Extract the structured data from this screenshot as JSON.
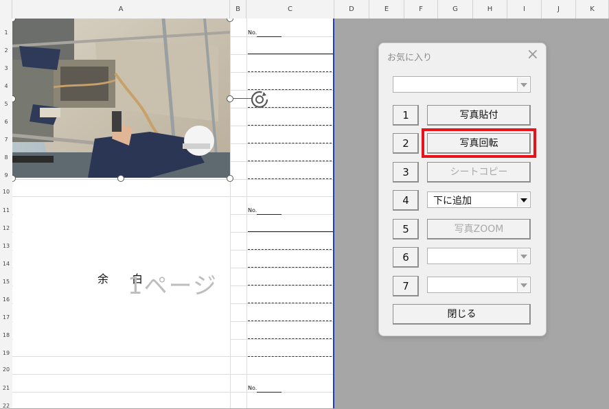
{
  "columns": [
    "A",
    "B",
    "C",
    "D",
    "E",
    "F",
    "G",
    "H",
    "I",
    "J",
    "K"
  ],
  "rows": [
    "1",
    "2",
    "3",
    "4",
    "5",
    "6",
    "7",
    "8",
    "9",
    "10",
    "11",
    "12",
    "13",
    "14",
    "15",
    "16",
    "17",
    "18",
    "19",
    "20",
    "21",
    "22"
  ],
  "sheet": {
    "no_label": "No.",
    "margin_char1": "余",
    "margin_char2": "白",
    "page_watermark": "1ページ"
  },
  "dialog": {
    "title": "お気に入り",
    "close_icon": "close-icon",
    "top_combo_value": "",
    "items": [
      {
        "num": "1",
        "type": "button",
        "label": "写真貼付",
        "enabled": true
      },
      {
        "num": "2",
        "type": "button",
        "label": "写真回転",
        "enabled": true,
        "highlighted": true
      },
      {
        "num": "3",
        "type": "button",
        "label": "シートコピー",
        "enabled": false
      },
      {
        "num": "4",
        "type": "combo",
        "value": "下に追加",
        "enabled": true
      },
      {
        "num": "5",
        "type": "button",
        "label": "写真ZOOM",
        "enabled": false
      },
      {
        "num": "6",
        "type": "combo",
        "value": "",
        "enabled": false
      },
      {
        "num": "7",
        "type": "combo",
        "value": "",
        "enabled": false
      }
    ],
    "close_label": "閉じる"
  },
  "colors": {
    "highlight": "#e5141a",
    "page_border": "#1b3fb3",
    "outside_area": "#a6a6a6"
  }
}
